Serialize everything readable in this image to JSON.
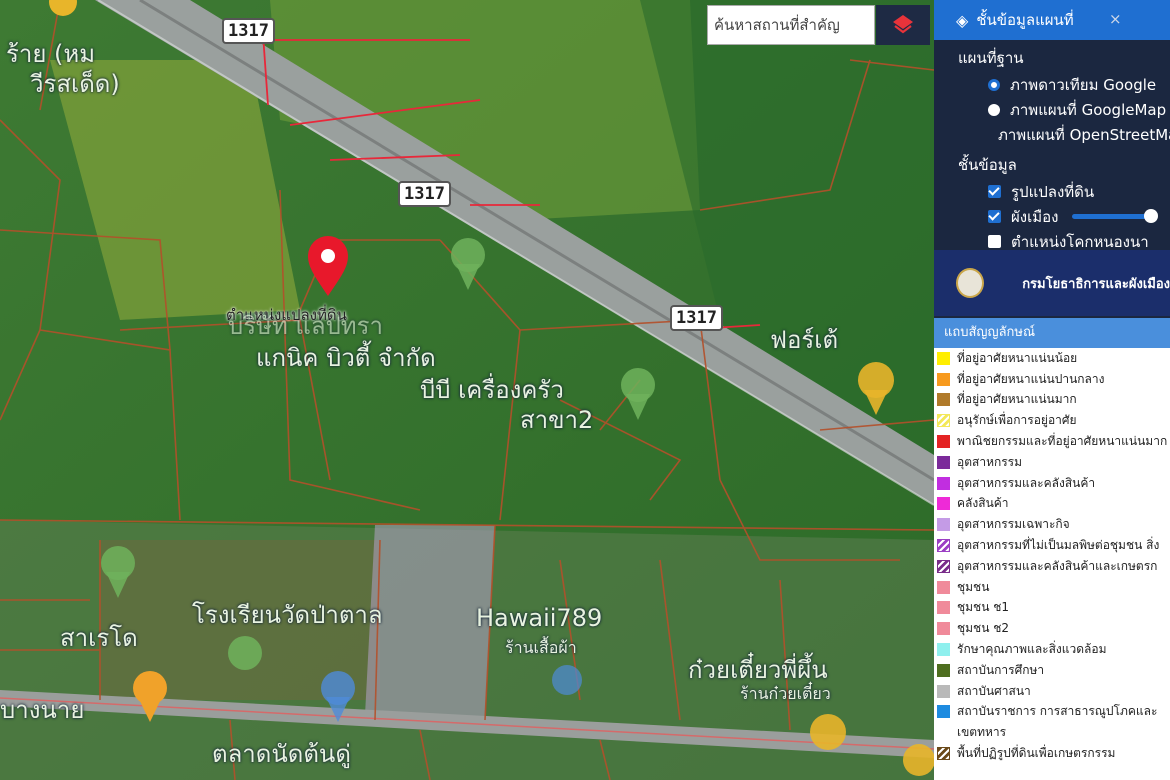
{
  "search": {
    "placeholder": "ค้นหาสถานที่สำคัญ"
  },
  "map": {
    "road_shields": [
      "1317",
      "1317",
      "1317"
    ],
    "pin_caption": "ตำแหน่งแปลงที่ดิน",
    "labels": [
      "ร้าย (หม",
      "วีรสเด็ด)",
      "บริษัท แลปทรา",
      "แกนิค บิวตี้ จำกัด",
      "บีบี เครื่องครัว",
      "สาขา2",
      "ฟอร์เต้",
      "โรงเรียนวัดป่าตาล",
      "สาเรโด",
      "Hawaii789",
      "ร้านเสื้อผ้า",
      "ก๋วยเตี๋ยวพี่ผึ้น",
      "ร้านก๋วยเตี๋ยว",
      "ตลาดนัดต้นดู่",
      "บางนาย"
    ]
  },
  "panel": {
    "title": "ชั้นข้อมูลแผนที่",
    "close": "×",
    "basemap_heading": "แผนที่ฐาน",
    "basemaps": [
      {
        "label": "ภาพดาวเทียม Google",
        "selected": true
      },
      {
        "label": "ภาพแผนที่ GoogleMap",
        "selected": false
      },
      {
        "label": "ภาพแผนที่ OpenStreetMap",
        "selected": false
      }
    ],
    "layers_heading": "ชั้นข้อมูล",
    "layers": [
      {
        "label": "รูปแปลงที่ดิน",
        "checked": true
      },
      {
        "label": "ผังเมือง",
        "checked": true
      },
      {
        "label": "ตำแหน่งโคกหนองนา",
        "checked": false
      }
    ],
    "opacity": 0.9,
    "department": "กรมโยธาธิการและผังเมือง"
  },
  "legend": {
    "title": "แถบสัญญลักษณ์",
    "items": [
      {
        "label": "ที่อยู่อาศัยหนาแน่นน้อย",
        "color": "#ffee00"
      },
      {
        "label": "ที่อยู่อาศัยหนาแน่นปานกลาง",
        "color": "#f79a1e"
      },
      {
        "label": "ที่อยู่อาศัยหนาแน่นมาก",
        "color": "#b07a2a"
      },
      {
        "label": "อนุรักษ์เพื่อการอยู่อาศัย",
        "color": "#f3e85a",
        "pattern": "hatch"
      },
      {
        "label": "พาณิชยกรรมและที่อยู่อาศัยหนาแน่นมาก",
        "color": "#e42323"
      },
      {
        "label": "อุตสาหกรรม",
        "color": "#7b2a9a"
      },
      {
        "label": "อุตสาหกรรมและคลังสินค้า",
        "color": "#c12ee0"
      },
      {
        "label": "คลังสินค้า",
        "color": "#ee2ad7"
      },
      {
        "label": "อุตสาหกรรมเฉพาะกิจ",
        "color": "#c49be6"
      },
      {
        "label": "อุตสาหกรรมที่ไม่เป็นมลพิษต่อชุมชน สิ่ง",
        "color": "#9b3fc4",
        "pattern": "hatch"
      },
      {
        "label": "อุตสาหกรรมและคลังสินค้าและเกษตรก",
        "color": "#7a2d8a",
        "pattern": "hatch"
      },
      {
        "label": "ชุมชน",
        "color": "#f08a9a"
      },
      {
        "label": "ชุมชน  ช1",
        "color": "#f08a9a"
      },
      {
        "label": "ชุมชน  ช2",
        "color": "#f08a9a"
      },
      {
        "label": "รักษาคุณภาพและสิ่งแวดล้อม",
        "color": "#8ff0ee"
      },
      {
        "label": "สถาบันการศึกษา",
        "color": "#4e6e1f"
      },
      {
        "label": "สถาบันศาสนา",
        "color": "#b9b9b9"
      },
      {
        "label": "สถาบันราชการ การสาธารณูปโภคและ",
        "color": "#1e8be0"
      },
      {
        "label": "เขตทหาร",
        "color": ""
      },
      {
        "label": "พื้นที่ปฏิรูปที่ดินเพื่อเกษตรกรรม",
        "color": "#6b4a1a",
        "pattern": "hatch"
      }
    ]
  },
  "colors": {
    "panel_bg": "#1b2740",
    "header_blue": "#1f6fd1",
    "pin_red": "#e8182b",
    "parcel_line": "#b4502a"
  }
}
